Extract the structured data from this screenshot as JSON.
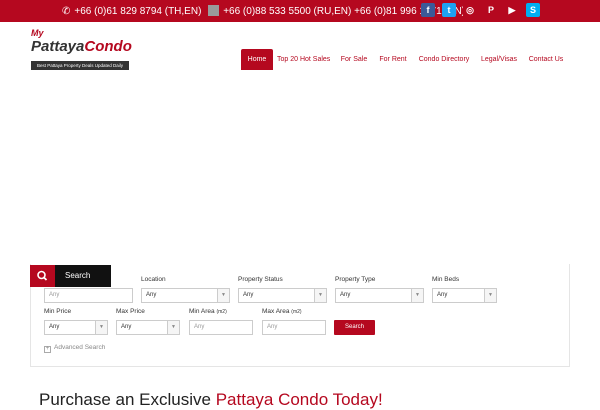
{
  "topbar": {
    "phone1": "+66 (0)61 829 8794 (TH,EN)",
    "phone2": "+66 (0)88 533 5500 (RU,EN) +66 (0)81 996 1971 (EN)",
    "socials": [
      {
        "name": "facebook-icon",
        "glyph": "f",
        "color": "#3b5998"
      },
      {
        "name": "twitter-icon",
        "glyph": "t",
        "color": "#1da1f2"
      },
      {
        "name": "instagram-icon",
        "glyph": "◎",
        "color": "#b5081f"
      },
      {
        "name": "pinterest-icon",
        "glyph": "P",
        "color": "#b5081f"
      },
      {
        "name": "youtube-icon",
        "glyph": "▶",
        "color": "#b5081f"
      },
      {
        "name": "skype-icon",
        "glyph": "S",
        "color": "#00aff0"
      }
    ]
  },
  "logo": {
    "my": "My",
    "brand_main": "Pattaya",
    "brand_accent": "Condo",
    "tagline": "Best Pattaya Property Deals Updated Daily"
  },
  "nav": {
    "items": [
      "Home",
      "Top 20 Hot Sales",
      "For Sale",
      "For Rent",
      "Condo Directory",
      "Legal/Visas",
      "Contact Us"
    ]
  },
  "search": {
    "tab_label": "Search",
    "keyword_placeholder": "Any",
    "location_label": "Location",
    "location_value": "Any",
    "status_label": "Property Status",
    "status_value": "Any",
    "type_label": "Property Type",
    "type_value": "Any",
    "beds_label": "Min Beds",
    "beds_value": "Any",
    "min_price_label": "Min Price",
    "min_price_value": "Any",
    "max_price_label": "Max Price",
    "max_price_value": "Any",
    "min_area_label": "Min Area",
    "area_unit": "(m2)",
    "min_area_placeholder": "Any",
    "max_area_label": "Max Area",
    "max_area_placeholder": "Any",
    "button_label": "Search",
    "advanced_label": "Advanced Search"
  },
  "headline": {
    "prefix": "Purchase an Exclusive ",
    "accent": "Pattaya Condo Today!"
  },
  "colors": {
    "brand": "#b5081f",
    "dark": "#111111"
  }
}
